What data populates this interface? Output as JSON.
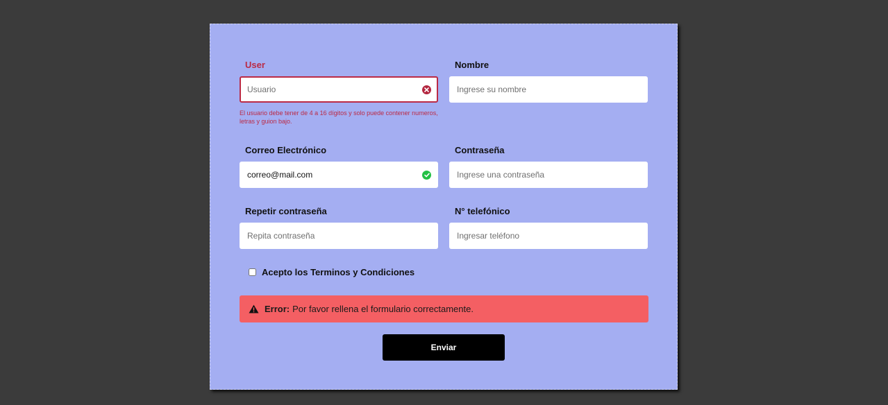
{
  "form": {
    "user": {
      "label": "User",
      "placeholder": "Usuario",
      "value": "",
      "error_message": "El usuario debe tener de 4 a 16 dígitos y solo puede contener numeros, letras y guion bajo."
    },
    "nombre": {
      "label": "Nombre",
      "placeholder": "Ingrese su nombre",
      "value": ""
    },
    "correo": {
      "label": "Correo Electrónico",
      "placeholder": "",
      "value": "correo@mail.com"
    },
    "password": {
      "label": "Contraseña",
      "placeholder": "Ingrese una contraseña",
      "value": ""
    },
    "password2": {
      "label": "Repetir contraseña",
      "placeholder": "Repita contraseña",
      "value": ""
    },
    "telefono": {
      "label": "N° telefónico",
      "placeholder": "Ingresar teléfono",
      "value": ""
    },
    "terms_label": "Acepto los Terminos y Condiciones",
    "error_alert": {
      "title": "Error:",
      "message": "Por favor rellena el formulario correctamente."
    },
    "submit_label": "Enviar"
  },
  "icons": {
    "invalid": "times-circle-icon",
    "valid": "check-circle-icon",
    "warning": "warning-triangle-icon"
  },
  "colors": {
    "card_background": "#a4aef2",
    "page_background": "#3b3b3b",
    "error": "#bb2a45",
    "success": "#23c045",
    "alert_background": "#f45f63",
    "submit_background": "#000000"
  }
}
